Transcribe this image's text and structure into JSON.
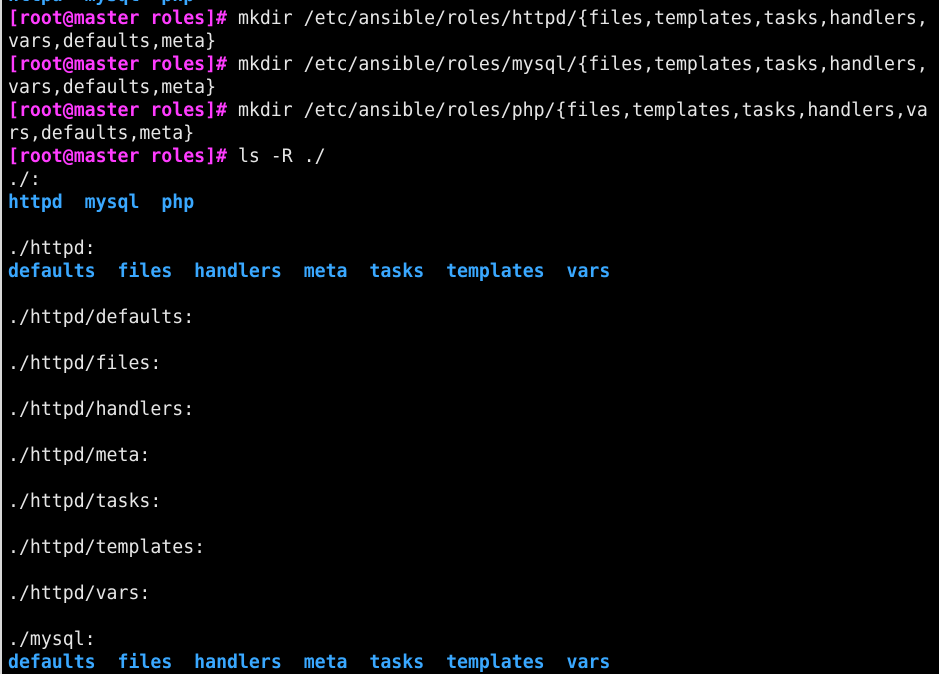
{
  "terminal": {
    "colors": {
      "prompt": "#ff3cff",
      "directory": "#3aa8ff",
      "text": "#e6e6e6",
      "background": "#000000"
    },
    "lines": [
      [
        {
          "t": "dir",
          "v": "httpd  mysql  php"
        }
      ],
      [
        {
          "t": "prompt",
          "v": "[root@master roles]#"
        },
        {
          "t": "out",
          "v": " mkdir /etc/ansible/roles/httpd/{files,templates,tasks,handlers,"
        }
      ],
      [
        {
          "t": "out",
          "v": "vars,defaults,meta}"
        }
      ],
      [
        {
          "t": "prompt",
          "v": "[root@master roles]#"
        },
        {
          "t": "out",
          "v": " mkdir /etc/ansible/roles/mysql/{files,templates,tasks,handlers,"
        }
      ],
      [
        {
          "t": "out",
          "v": "vars,defaults,meta}"
        }
      ],
      [
        {
          "t": "prompt",
          "v": "[root@master roles]#"
        },
        {
          "t": "out",
          "v": " mkdir /etc/ansible/roles/php/{files,templates,tasks,handlers,va"
        }
      ],
      [
        {
          "t": "out",
          "v": "rs,defaults,meta}"
        }
      ],
      [
        {
          "t": "prompt",
          "v": "[root@master roles]#"
        },
        {
          "t": "out",
          "v": " ls -R ./"
        }
      ],
      [
        {
          "t": "out",
          "v": "./:"
        }
      ],
      [
        {
          "t": "dir",
          "v": "httpd"
        },
        {
          "t": "out",
          "v": "  "
        },
        {
          "t": "dir",
          "v": "mysql"
        },
        {
          "t": "out",
          "v": "  "
        },
        {
          "t": "dir",
          "v": "php"
        }
      ],
      [],
      [
        {
          "t": "out",
          "v": "./httpd:"
        }
      ],
      [
        {
          "t": "dir",
          "v": "defaults"
        },
        {
          "t": "out",
          "v": "  "
        },
        {
          "t": "dir",
          "v": "files"
        },
        {
          "t": "out",
          "v": "  "
        },
        {
          "t": "dir",
          "v": "handlers"
        },
        {
          "t": "out",
          "v": "  "
        },
        {
          "t": "dir",
          "v": "meta"
        },
        {
          "t": "out",
          "v": "  "
        },
        {
          "t": "dir",
          "v": "tasks"
        },
        {
          "t": "out",
          "v": "  "
        },
        {
          "t": "dir",
          "v": "templates"
        },
        {
          "t": "out",
          "v": "  "
        },
        {
          "t": "dir",
          "v": "vars"
        }
      ],
      [],
      [
        {
          "t": "out",
          "v": "./httpd/defaults:"
        }
      ],
      [],
      [
        {
          "t": "out",
          "v": "./httpd/files:"
        }
      ],
      [],
      [
        {
          "t": "out",
          "v": "./httpd/handlers:"
        }
      ],
      [],
      [
        {
          "t": "out",
          "v": "./httpd/meta:"
        }
      ],
      [],
      [
        {
          "t": "out",
          "v": "./httpd/tasks:"
        }
      ],
      [],
      [
        {
          "t": "out",
          "v": "./httpd/templates:"
        }
      ],
      [],
      [
        {
          "t": "out",
          "v": "./httpd/vars:"
        }
      ],
      [],
      [
        {
          "t": "out",
          "v": "./mysql:"
        }
      ],
      [
        {
          "t": "dir",
          "v": "defaults"
        },
        {
          "t": "out",
          "v": "  "
        },
        {
          "t": "dir",
          "v": "files"
        },
        {
          "t": "out",
          "v": "  "
        },
        {
          "t": "dir",
          "v": "handlers"
        },
        {
          "t": "out",
          "v": "  "
        },
        {
          "t": "dir",
          "v": "meta"
        },
        {
          "t": "out",
          "v": "  "
        },
        {
          "t": "dir",
          "v": "tasks"
        },
        {
          "t": "out",
          "v": "  "
        },
        {
          "t": "dir",
          "v": "templates"
        },
        {
          "t": "out",
          "v": "  "
        },
        {
          "t": "dir",
          "v": "vars"
        }
      ]
    ]
  }
}
